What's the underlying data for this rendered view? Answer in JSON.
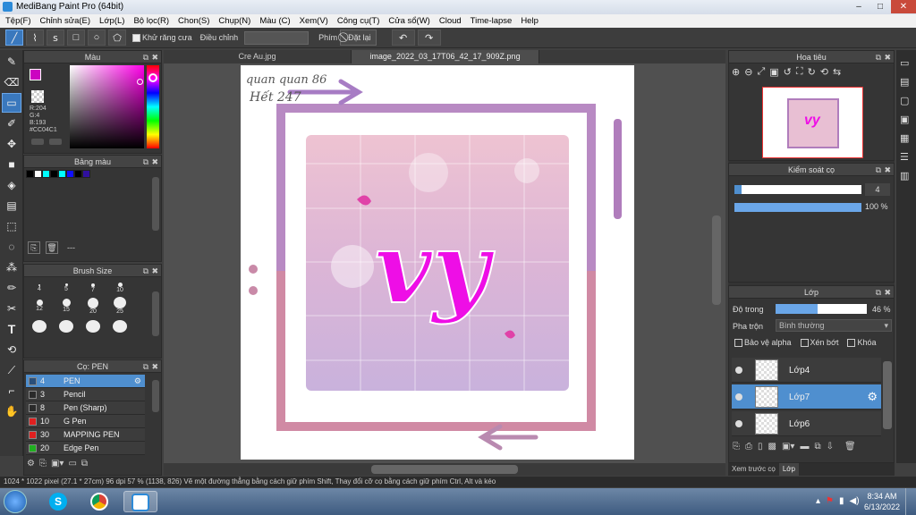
{
  "window": {
    "title": "MediBang Paint Pro (64bit)"
  },
  "menu": [
    "Tệp(F)",
    "Chỉnh sửa(E)",
    "Lớp(L)",
    "Bộ lọc(R)",
    "Chon(S)",
    "Chụp(N)",
    "Màu (C)",
    "Xem(V)",
    "Công cụ(T)",
    "Cửa sổ(W)",
    "Cloud",
    "Time-lapse",
    "Help"
  ],
  "toolbar": {
    "antialias_label": "Khử răng cưa",
    "adjust_label": "Điều chỉnh",
    "key_label": "Phím",
    "reset_label": "Đặt lại"
  },
  "color_panel": {
    "title": "Màu",
    "r": "R:204",
    "g": "G:4",
    "b": "B:193",
    "hex": "#CC04C1",
    "accent": "#CC04C1"
  },
  "palette_panel": {
    "title": "Bảng màu",
    "colors": [
      "#000000",
      "#ffffff",
      "#00ffff",
      "#000000",
      "#00ffff",
      "#1010ff",
      "#000000",
      "#3010a0"
    ],
    "footer": "---"
  },
  "brush_size_panel": {
    "title": "Brush Size",
    "sizes": [
      "4",
      "5",
      "7",
      "10",
      "12",
      "15",
      "20",
      "25"
    ]
  },
  "pen_panel": {
    "title": "Cọ: PEN",
    "items": [
      {
        "size": "4",
        "name": "PEN",
        "color": "#2a4f7a"
      },
      {
        "size": "3",
        "name": "Pencil",
        "color": "#2a2a2a"
      },
      {
        "size": "8",
        "name": "Pen (Sharp)",
        "color": "#2a2a2a"
      },
      {
        "size": "10",
        "name": "G Pen",
        "color": "#e02020"
      },
      {
        "size": "30",
        "name": "MAPPING PEN",
        "color": "#e02020"
      },
      {
        "size": "20",
        "name": "Edge Pen",
        "color": "#20b020"
      }
    ]
  },
  "tabs": [
    "Cre Au.jpg",
    "image_2022_03_17T06_42_17_909Z.png"
  ],
  "artwork": {
    "note_line1": "quan quan 86",
    "note_line2": "Hết 247",
    "text": "vy"
  },
  "navigator": {
    "title": "Hoa tiêu"
  },
  "brush_control": {
    "title": "Kiểm soát cọ",
    "size_value": "4",
    "opacity_value": "100 %",
    "opacity_fraction": 1.0
  },
  "layer_panel": {
    "title": "Lớp",
    "opacity_label": "Độ trong",
    "opacity_value": "46 %",
    "opacity_fraction": 0.46,
    "blend_label": "Pha trộn",
    "blend_value": "Bình thường",
    "protect_alpha": "Bảo vệ alpha",
    "clip": "Xén bớt",
    "lock": "Khóa",
    "layers": [
      {
        "name": "Lớp4"
      },
      {
        "name": "Lớp7"
      },
      {
        "name": "Lớp6"
      }
    ],
    "tabs": [
      "Xem trước cọ",
      "Lớp"
    ]
  },
  "status": {
    "size": "1024 * 1022 pixel",
    "cm": "(27.1 * 27cm)",
    "dpi": "96 dpi",
    "zoom": "57 %",
    "coords": "(1138, 826)",
    "hint": "Vẽ một đường thẳng bằng cách giữ phím Shift, Thay đổi cỡ cọ bằng cách giữ phím Ctrl, Alt và kéo"
  },
  "clock": {
    "time": "8:34 AM",
    "date": "6/13/2022"
  }
}
